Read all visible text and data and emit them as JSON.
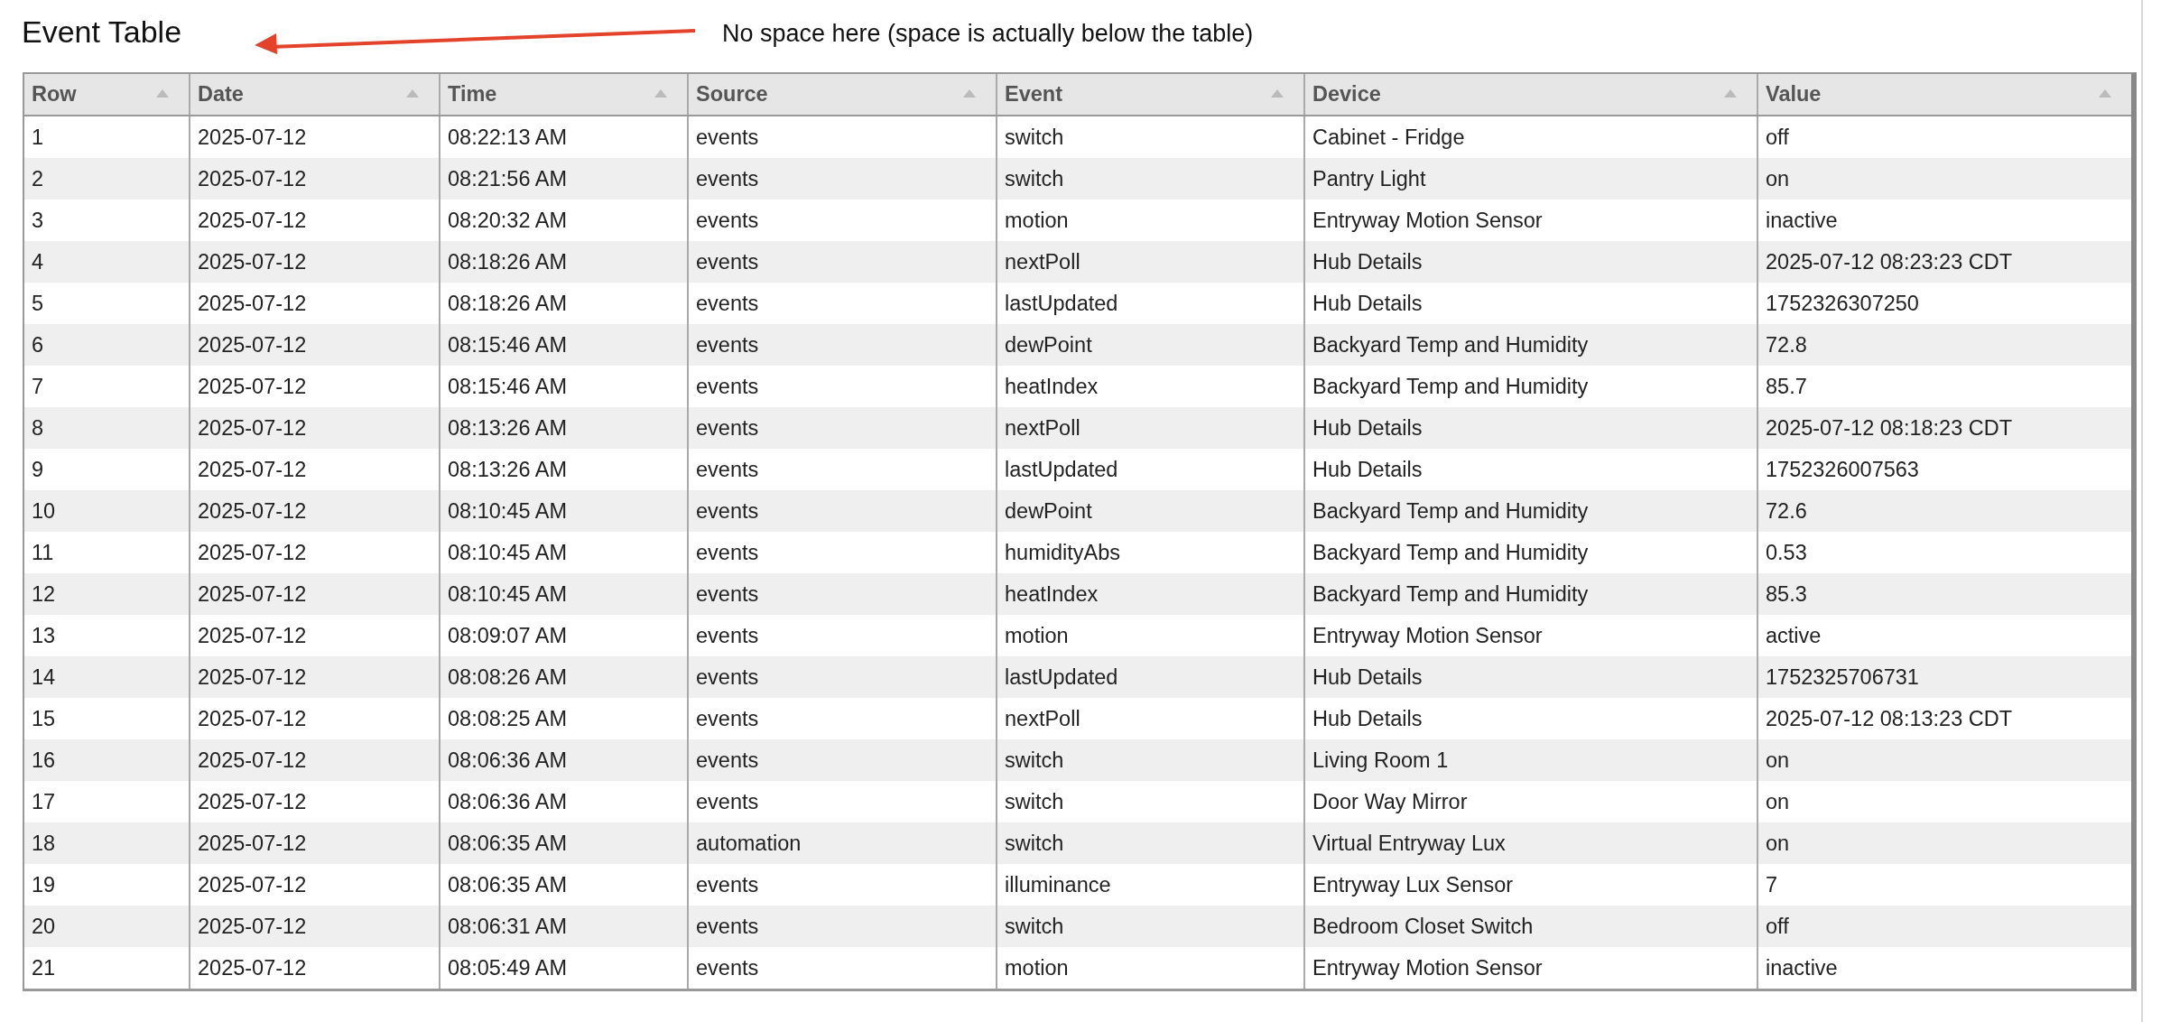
{
  "title": "Event Table",
  "annotation": {
    "text": "No space here (space is actually below the table)"
  },
  "table": {
    "columns": [
      "Row",
      "Date",
      "Time",
      "Source",
      "Event",
      "Device",
      "Value"
    ],
    "rows": [
      [
        "1",
        "2025-07-12",
        "08:22:13 AM",
        "events",
        "switch",
        "Cabinet - Fridge",
        "off"
      ],
      [
        "2",
        "2025-07-12",
        "08:21:56 AM",
        "events",
        "switch",
        "Pantry Light",
        "on"
      ],
      [
        "3",
        "2025-07-12",
        "08:20:32 AM",
        "events",
        "motion",
        "Entryway Motion Sensor",
        "inactive"
      ],
      [
        "4",
        "2025-07-12",
        "08:18:26 AM",
        "events",
        "nextPoll",
        "Hub Details",
        "2025-07-12 08:23:23 CDT"
      ],
      [
        "5",
        "2025-07-12",
        "08:18:26 AM",
        "events",
        "lastUpdated",
        "Hub Details",
        "1752326307250"
      ],
      [
        "6",
        "2025-07-12",
        "08:15:46 AM",
        "events",
        "dewPoint",
        "Backyard Temp and Humidity",
        "72.8"
      ],
      [
        "7",
        "2025-07-12",
        "08:15:46 AM",
        "events",
        "heatIndex",
        "Backyard Temp and Humidity",
        "85.7"
      ],
      [
        "8",
        "2025-07-12",
        "08:13:26 AM",
        "events",
        "nextPoll",
        "Hub Details",
        "2025-07-12 08:18:23 CDT"
      ],
      [
        "9",
        "2025-07-12",
        "08:13:26 AM",
        "events",
        "lastUpdated",
        "Hub Details",
        "1752326007563"
      ],
      [
        "10",
        "2025-07-12",
        "08:10:45 AM",
        "events",
        "dewPoint",
        "Backyard Temp and Humidity",
        "72.6"
      ],
      [
        "11",
        "2025-07-12",
        "08:10:45 AM",
        "events",
        "humidityAbs",
        "Backyard Temp and Humidity",
        "0.53"
      ],
      [
        "12",
        "2025-07-12",
        "08:10:45 AM",
        "events",
        "heatIndex",
        "Backyard Temp and Humidity",
        "85.3"
      ],
      [
        "13",
        "2025-07-12",
        "08:09:07 AM",
        "events",
        "motion",
        "Entryway Motion Sensor",
        "active"
      ],
      [
        "14",
        "2025-07-12",
        "08:08:26 AM",
        "events",
        "lastUpdated",
        "Hub Details",
        "1752325706731"
      ],
      [
        "15",
        "2025-07-12",
        "08:08:25 AM",
        "events",
        "nextPoll",
        "Hub Details",
        "2025-07-12 08:13:23 CDT"
      ],
      [
        "16",
        "2025-07-12",
        "08:06:36 AM",
        "events",
        "switch",
        "Living Room 1",
        "on"
      ],
      [
        "17",
        "2025-07-12",
        "08:06:36 AM",
        "events",
        "switch",
        "Door Way Mirror",
        "on"
      ],
      [
        "18",
        "2025-07-12",
        "08:06:35 AM",
        "automation",
        "switch",
        "Virtual Entryway Lux",
        "on"
      ],
      [
        "19",
        "2025-07-12",
        "08:06:35 AM",
        "events",
        "illuminance",
        "Entryway Lux Sensor",
        "7"
      ],
      [
        "20",
        "2025-07-12",
        "08:06:31 AM",
        "events",
        "switch",
        "Bedroom Closet Switch",
        "off"
      ],
      [
        "21",
        "2025-07-12",
        "08:05:49 AM",
        "events",
        "motion",
        "Entryway Motion Sensor",
        "inactive"
      ]
    ]
  }
}
